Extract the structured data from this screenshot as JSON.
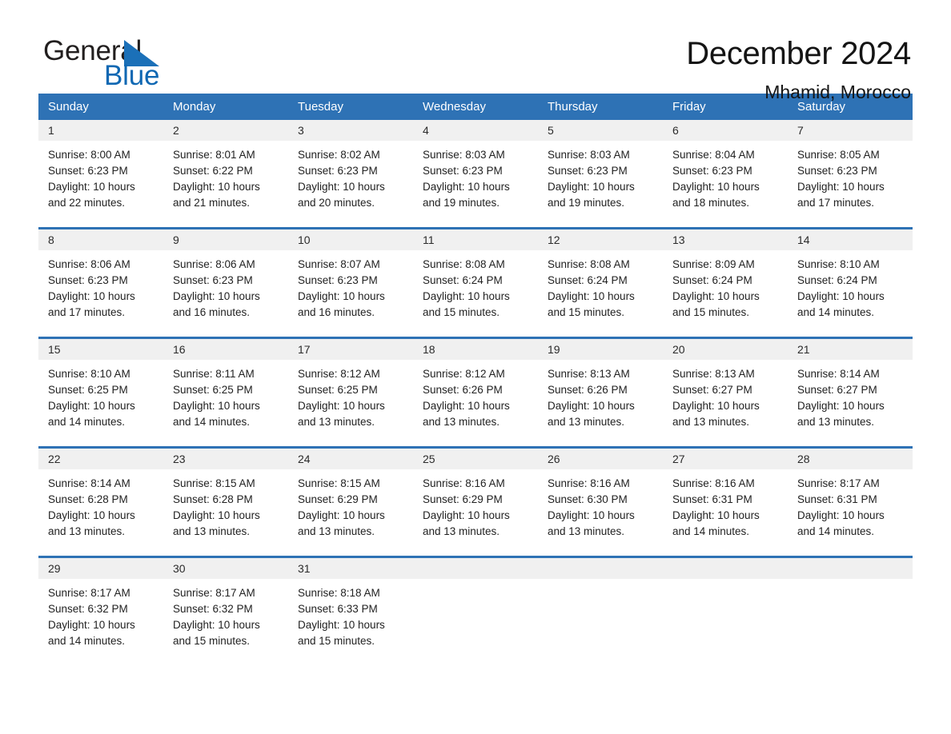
{
  "brand": {
    "name_part1": "General",
    "name_part2": "Blue",
    "triangle_color": "#1b70b8",
    "text_color_1": "#221f1f",
    "text_color_2": "#1068b3"
  },
  "header": {
    "title": "December 2024",
    "subtitle": "Mhamid, Morocco"
  },
  "theme": {
    "header_blue": "#2e72b5",
    "daynum_band": "#f0f0f0",
    "text": "#222222"
  },
  "calendar": {
    "weekdays": [
      "Sunday",
      "Monday",
      "Tuesday",
      "Wednesday",
      "Thursday",
      "Friday",
      "Saturday"
    ],
    "weeks": [
      {
        "days": [
          {
            "num": "1",
            "sunrise": "Sunrise: 8:00 AM",
            "sunset": "Sunset: 6:23 PM",
            "daylight_line1": "Daylight: 10 hours",
            "daylight_line2": "and 22 minutes."
          },
          {
            "num": "2",
            "sunrise": "Sunrise: 8:01 AM",
            "sunset": "Sunset: 6:22 PM",
            "daylight_line1": "Daylight: 10 hours",
            "daylight_line2": "and 21 minutes."
          },
          {
            "num": "3",
            "sunrise": "Sunrise: 8:02 AM",
            "sunset": "Sunset: 6:23 PM",
            "daylight_line1": "Daylight: 10 hours",
            "daylight_line2": "and 20 minutes."
          },
          {
            "num": "4",
            "sunrise": "Sunrise: 8:03 AM",
            "sunset": "Sunset: 6:23 PM",
            "daylight_line1": "Daylight: 10 hours",
            "daylight_line2": "and 19 minutes."
          },
          {
            "num": "5",
            "sunrise": "Sunrise: 8:03 AM",
            "sunset": "Sunset: 6:23 PM",
            "daylight_line1": "Daylight: 10 hours",
            "daylight_line2": "and 19 minutes."
          },
          {
            "num": "6",
            "sunrise": "Sunrise: 8:04 AM",
            "sunset": "Sunset: 6:23 PM",
            "daylight_line1": "Daylight: 10 hours",
            "daylight_line2": "and 18 minutes."
          },
          {
            "num": "7",
            "sunrise": "Sunrise: 8:05 AM",
            "sunset": "Sunset: 6:23 PM",
            "daylight_line1": "Daylight: 10 hours",
            "daylight_line2": "and 17 minutes."
          }
        ]
      },
      {
        "days": [
          {
            "num": "8",
            "sunrise": "Sunrise: 8:06 AM",
            "sunset": "Sunset: 6:23 PM",
            "daylight_line1": "Daylight: 10 hours",
            "daylight_line2": "and 17 minutes."
          },
          {
            "num": "9",
            "sunrise": "Sunrise: 8:06 AM",
            "sunset": "Sunset: 6:23 PM",
            "daylight_line1": "Daylight: 10 hours",
            "daylight_line2": "and 16 minutes."
          },
          {
            "num": "10",
            "sunrise": "Sunrise: 8:07 AM",
            "sunset": "Sunset: 6:23 PM",
            "daylight_line1": "Daylight: 10 hours",
            "daylight_line2": "and 16 minutes."
          },
          {
            "num": "11",
            "sunrise": "Sunrise: 8:08 AM",
            "sunset": "Sunset: 6:24 PM",
            "daylight_line1": "Daylight: 10 hours",
            "daylight_line2": "and 15 minutes."
          },
          {
            "num": "12",
            "sunrise": "Sunrise: 8:08 AM",
            "sunset": "Sunset: 6:24 PM",
            "daylight_line1": "Daylight: 10 hours",
            "daylight_line2": "and 15 minutes."
          },
          {
            "num": "13",
            "sunrise": "Sunrise: 8:09 AM",
            "sunset": "Sunset: 6:24 PM",
            "daylight_line1": "Daylight: 10 hours",
            "daylight_line2": "and 15 minutes."
          },
          {
            "num": "14",
            "sunrise": "Sunrise: 8:10 AM",
            "sunset": "Sunset: 6:24 PM",
            "daylight_line1": "Daylight: 10 hours",
            "daylight_line2": "and 14 minutes."
          }
        ]
      },
      {
        "days": [
          {
            "num": "15",
            "sunrise": "Sunrise: 8:10 AM",
            "sunset": "Sunset: 6:25 PM",
            "daylight_line1": "Daylight: 10 hours",
            "daylight_line2": "and 14 minutes."
          },
          {
            "num": "16",
            "sunrise": "Sunrise: 8:11 AM",
            "sunset": "Sunset: 6:25 PM",
            "daylight_line1": "Daylight: 10 hours",
            "daylight_line2": "and 14 minutes."
          },
          {
            "num": "17",
            "sunrise": "Sunrise: 8:12 AM",
            "sunset": "Sunset: 6:25 PM",
            "daylight_line1": "Daylight: 10 hours",
            "daylight_line2": "and 13 minutes."
          },
          {
            "num": "18",
            "sunrise": "Sunrise: 8:12 AM",
            "sunset": "Sunset: 6:26 PM",
            "daylight_line1": "Daylight: 10 hours",
            "daylight_line2": "and 13 minutes."
          },
          {
            "num": "19",
            "sunrise": "Sunrise: 8:13 AM",
            "sunset": "Sunset: 6:26 PM",
            "daylight_line1": "Daylight: 10 hours",
            "daylight_line2": "and 13 minutes."
          },
          {
            "num": "20",
            "sunrise": "Sunrise: 8:13 AM",
            "sunset": "Sunset: 6:27 PM",
            "daylight_line1": "Daylight: 10 hours",
            "daylight_line2": "and 13 minutes."
          },
          {
            "num": "21",
            "sunrise": "Sunrise: 8:14 AM",
            "sunset": "Sunset: 6:27 PM",
            "daylight_line1": "Daylight: 10 hours",
            "daylight_line2": "and 13 minutes."
          }
        ]
      },
      {
        "days": [
          {
            "num": "22",
            "sunrise": "Sunrise: 8:14 AM",
            "sunset": "Sunset: 6:28 PM",
            "daylight_line1": "Daylight: 10 hours",
            "daylight_line2": "and 13 minutes."
          },
          {
            "num": "23",
            "sunrise": "Sunrise: 8:15 AM",
            "sunset": "Sunset: 6:28 PM",
            "daylight_line1": "Daylight: 10 hours",
            "daylight_line2": "and 13 minutes."
          },
          {
            "num": "24",
            "sunrise": "Sunrise: 8:15 AM",
            "sunset": "Sunset: 6:29 PM",
            "daylight_line1": "Daylight: 10 hours",
            "daylight_line2": "and 13 minutes."
          },
          {
            "num": "25",
            "sunrise": "Sunrise: 8:16 AM",
            "sunset": "Sunset: 6:29 PM",
            "daylight_line1": "Daylight: 10 hours",
            "daylight_line2": "and 13 minutes."
          },
          {
            "num": "26",
            "sunrise": "Sunrise: 8:16 AM",
            "sunset": "Sunset: 6:30 PM",
            "daylight_line1": "Daylight: 10 hours",
            "daylight_line2": "and 13 minutes."
          },
          {
            "num": "27",
            "sunrise": "Sunrise: 8:16 AM",
            "sunset": "Sunset: 6:31 PM",
            "daylight_line1": "Daylight: 10 hours",
            "daylight_line2": "and 14 minutes."
          },
          {
            "num": "28",
            "sunrise": "Sunrise: 8:17 AM",
            "sunset": "Sunset: 6:31 PM",
            "daylight_line1": "Daylight: 10 hours",
            "daylight_line2": "and 14 minutes."
          }
        ]
      },
      {
        "days": [
          {
            "num": "29",
            "sunrise": "Sunrise: 8:17 AM",
            "sunset": "Sunset: 6:32 PM",
            "daylight_line1": "Daylight: 10 hours",
            "daylight_line2": "and 14 minutes."
          },
          {
            "num": "30",
            "sunrise": "Sunrise: 8:17 AM",
            "sunset": "Sunset: 6:32 PM",
            "daylight_line1": "Daylight: 10 hours",
            "daylight_line2": "and 15 minutes."
          },
          {
            "num": "31",
            "sunrise": "Sunrise: 8:18 AM",
            "sunset": "Sunset: 6:33 PM",
            "daylight_line1": "Daylight: 10 hours",
            "daylight_line2": "and 15 minutes."
          },
          {
            "num": "",
            "sunrise": "",
            "sunset": "",
            "daylight_line1": "",
            "daylight_line2": ""
          },
          {
            "num": "",
            "sunrise": "",
            "sunset": "",
            "daylight_line1": "",
            "daylight_line2": ""
          },
          {
            "num": "",
            "sunrise": "",
            "sunset": "",
            "daylight_line1": "",
            "daylight_line2": ""
          },
          {
            "num": "",
            "sunrise": "",
            "sunset": "",
            "daylight_line1": "",
            "daylight_line2": ""
          }
        ]
      }
    ]
  }
}
